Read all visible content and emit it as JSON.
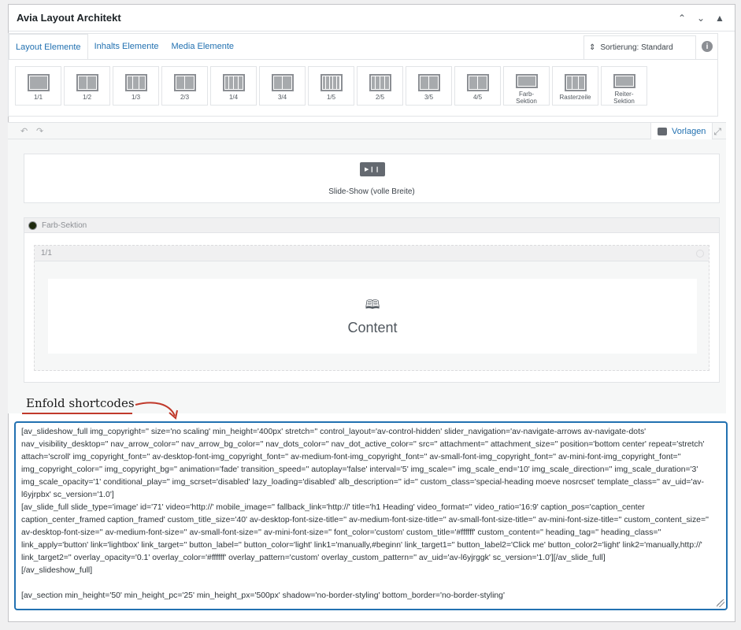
{
  "panel": {
    "title": "Avia Layout Architekt"
  },
  "tabs": [
    {
      "label": "Layout Elemente",
      "active": true
    },
    {
      "label": "Inhalts Elemente",
      "active": false
    },
    {
      "label": "Media Elemente",
      "active": false
    }
  ],
  "sort": {
    "label": "Sortierung: Standard",
    "icon": "sort-arrows-icon"
  },
  "elements": [
    {
      "label": "1/1",
      "cols": 1
    },
    {
      "label": "1/2",
      "cols": 2
    },
    {
      "label": "1/3",
      "cols": 3
    },
    {
      "label": "2/3",
      "cols": 2
    },
    {
      "label": "1/4",
      "cols": 4
    },
    {
      "label": "3/4",
      "cols": 2
    },
    {
      "label": "1/5",
      "cols": 5
    },
    {
      "label": "2/5",
      "cols": 4
    },
    {
      "label": "3/5",
      "cols": 2
    },
    {
      "label": "4/5",
      "cols": 2
    },
    {
      "label": "Farb-\nSektion",
      "cols": 1
    },
    {
      "label": "Rasterzeile",
      "cols": 3
    },
    {
      "label": "Reiter-\nSektion",
      "cols": 1
    }
  ],
  "toolbar": {
    "templates_label": "Vorlagen"
  },
  "canvas": {
    "slideshow_label": "Slide-Show (volle Breite)",
    "section_label": "Farb-Sektion",
    "column_label": "1/1",
    "content_label": "Content"
  },
  "annotation": {
    "text": "Enfold shortcodes",
    "color": "#c0392b"
  },
  "shortcode": "[av_slideshow_full img_copyright='' size='no scaling' min_height='400px' stretch='' control_layout='av-control-hidden' slider_navigation='av-navigate-arrows av-navigate-dots' nav_visibility_desktop='' nav_arrow_color='' nav_arrow_bg_color='' nav_dots_color='' nav_dot_active_color='' src='' attachment='' attachment_size='' position='bottom center' repeat='stretch' attach='scroll' img_copyright_font='' av-desktop-font-img_copyright_font='' av-medium-font-img_copyright_font='' av-small-font-img_copyright_font='' av-mini-font-img_copyright_font='' img_copyright_color='' img_copyright_bg='' animation='fade' transition_speed='' autoplay='false' interval='5' img_scale='' img_scale_end='10' img_scale_direction='' img_scale_duration='3' img_scale_opacity='1' conditional_play='' img_scrset='disabled' lazy_loading='disabled' alb_description='' id='' custom_class='special-heading moeve nosrcset' template_class='' av_uid='av-l6yjrpbx' sc_version='1.0']\n[av_slide_full slide_type='image' id='71' video='http://' mobile_image='' fallback_link='http://' title='h1 Heading' video_format='' video_ratio='16:9' caption_pos='caption_center caption_center_framed caption_framed' custom_title_size='40' av-desktop-font-size-title='' av-medium-font-size-title='' av-small-font-size-title='' av-mini-font-size-title='' custom_content_size='' av-desktop-font-size='' av-medium-font-size='' av-small-font-size='' av-mini-font-size='' font_color='custom' custom_title='#ffffff' custom_content='' heading_tag='' heading_class='' link_apply='button' link='lightbox' link_target='' button_label='' button_color='light' link1='manually,#beginn' link_target1='' button_label2='Click me' button_color2='light' link2='manually,http://' link_target2='' overlay_opacity='0.1' overlay_color='#ffffff' overlay_pattern='custom' overlay_custom_pattern='' av_uid='av-l6yjrggk' sc_version='1.0'][/av_slide_full]\n[/av_slideshow_full]\n\n[av_section min_height='50' min_height_pc='25' min_height_px='500px' shadow='no-border-styling' bottom_border='no-border-styling'"
}
